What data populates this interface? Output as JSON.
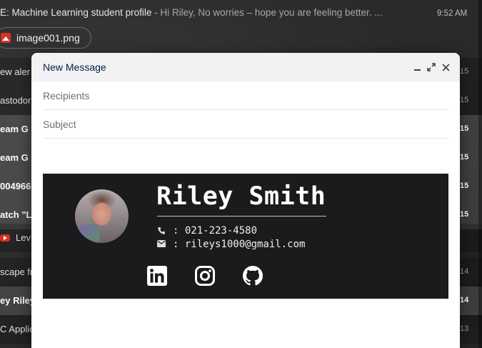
{
  "inbox": {
    "open_subject": "E: Machine Learning student profile",
    "open_snippet": " - Hi Riley, No worries – hope you are feeling better. ...",
    "open_time": "9:52 AM",
    "attachment": "image001.png",
    "rows": [
      {
        "label": "ew aler",
        "date": "15",
        "bold": false
      },
      {
        "label": "astodor",
        "date": "15",
        "bold": false
      },
      {
        "label": "eam G",
        "date": "15",
        "bold": true
      },
      {
        "label": "eam G",
        "date": "15",
        "bold": true
      },
      {
        "label": "004966",
        "date": "15",
        "bold": true
      },
      {
        "label": "atch \"L",
        "date": "15",
        "bold": true
      },
      {
        "label": "Lev",
        "date": "",
        "bold": false,
        "icon": "youtube-icon"
      },
      {
        "label": "scape fr",
        "date": "14",
        "bold": false
      },
      {
        "label": "ey Riley",
        "date": "14",
        "bold": true
      },
      {
        "label": "C Applic",
        "date": "13",
        "bold": false
      }
    ]
  },
  "compose": {
    "title": "New Message",
    "recipients_placeholder": "Recipients",
    "subject_placeholder": "Subject",
    "recipients_value": "",
    "subject_value": ""
  },
  "signature": {
    "name": "Riley Smith",
    "phone": ": 021-223-4580",
    "email": ": rileys1000@gmail.com",
    "icons": [
      "phone-icon",
      "envelope-icon",
      "linkedin-icon",
      "instagram-icon",
      "github-icon"
    ]
  }
}
